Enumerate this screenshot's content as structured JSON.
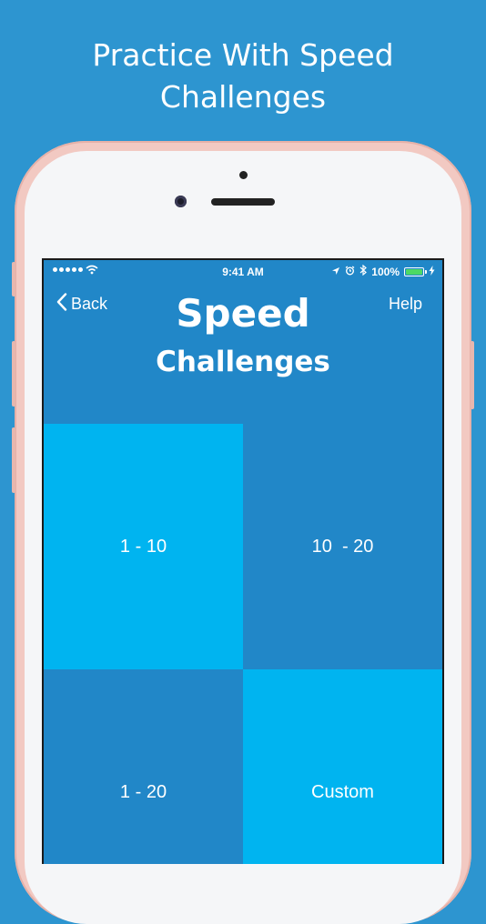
{
  "headline": {
    "line1": "Practice With Speed",
    "line2": "Challenges"
  },
  "status_bar": {
    "time": "9:41 AM",
    "battery": "100%"
  },
  "nav": {
    "back_label": "Back",
    "help_label": "Help"
  },
  "screen_title": {
    "line1": "Speed",
    "line2": "Challenges"
  },
  "tiles": [
    {
      "label": "1 - 10",
      "style": "light"
    },
    {
      "label": "10  - 20",
      "style": "dark"
    },
    {
      "label": "1 - 20",
      "style": "dark"
    },
    {
      "label": "Custom",
      "style": "light"
    }
  ],
  "colors": {
    "background": "#2d95d0",
    "screen": "#2187c8",
    "tile_light": "#00b4f0",
    "tile_dark": "#2187c8",
    "phone_frame": "#f2c9c2",
    "battery_fill": "#4cd964"
  },
  "icons": {
    "back": "chevron-left-icon",
    "wifi": "wifi-icon",
    "location": "location-arrow-icon",
    "alarm": "alarm-clock-icon",
    "bluetooth": "bluetooth-icon",
    "charging": "bolt-icon"
  }
}
